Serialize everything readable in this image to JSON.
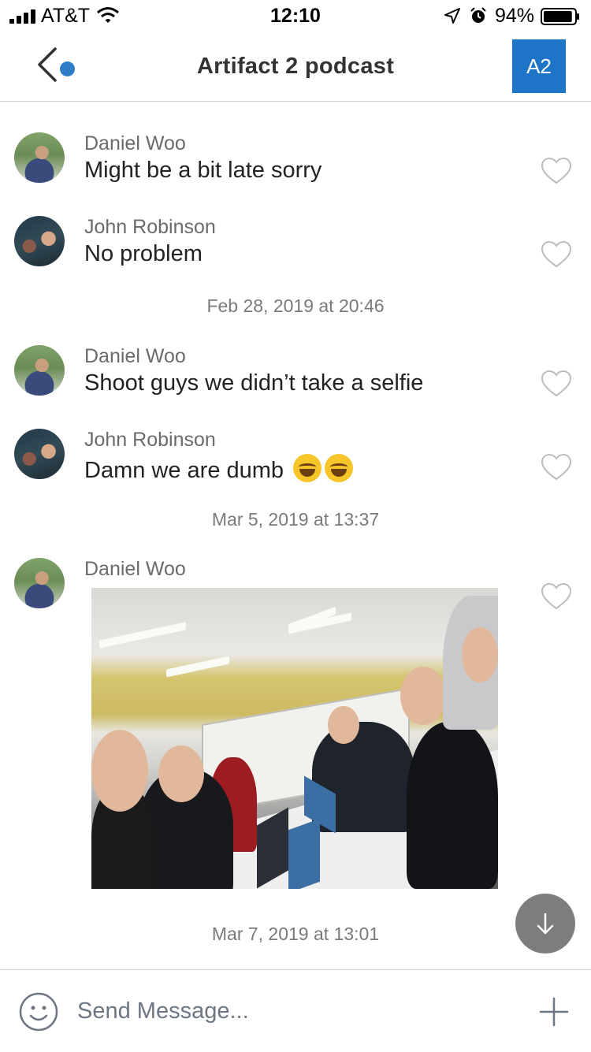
{
  "status_bar": {
    "carrier": "AT&T",
    "time": "12:10",
    "battery": "94%",
    "battery_level": 0.94
  },
  "nav": {
    "title": "Artifact 2 podcast",
    "group_avatar": "A2",
    "accent_color": "#1e74c6"
  },
  "messages": [
    {
      "sender": "Daniel Woo",
      "text": "Might be a bit late sorry"
    },
    {
      "sender": "John Robinson",
      "text": "No problem"
    },
    {
      "sender": "Daniel Woo",
      "text": "Shoot guys we didn’t take a selfie"
    },
    {
      "sender": "John Robinson",
      "text": "Damn we are dumb",
      "emoji": [
        "face-with-tears-of-joy",
        "face-with-tears-of-joy"
      ]
    },
    {
      "sender": "Daniel Woo",
      "attachment": "photo"
    }
  ],
  "timestamps": [
    "Feb 28, 2019 at 20:46",
    "Mar 5, 2019 at 13:37",
    "Mar 7, 2019 at 13:01"
  ],
  "composer": {
    "placeholder": "Send Message..."
  },
  "icons": {
    "back": "chevron-left-icon",
    "heart": "heart-outline-icon",
    "scroll": "arrow-down-icon",
    "emoji": "smiley-icon",
    "add": "plus-icon"
  }
}
